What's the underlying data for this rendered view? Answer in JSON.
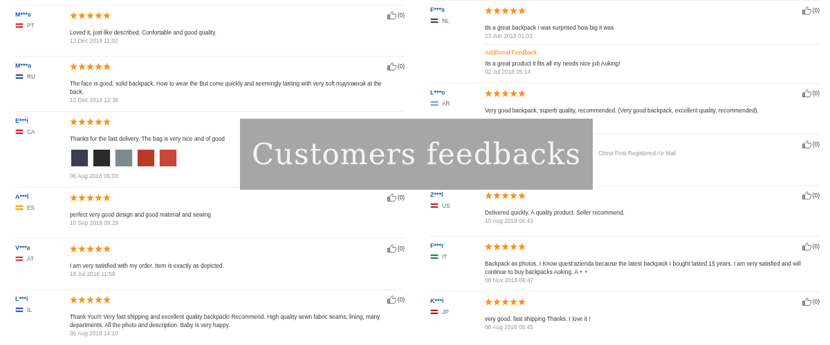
{
  "columns": [
    {
      "reviews": [
        {
          "user": "M***s",
          "country": "PT",
          "flag": {
            "color": "#d62828"
          },
          "stars": 5,
          "likes": "(0)",
          "comment": "Loved it, just like described. Confortable and good quality.",
          "date": "13 Dec 2018 11:02"
        },
        {
          "user": "M***a",
          "country": "RU",
          "flag": {
            "color": "#2a4fb0"
          },
          "stars": 5,
          "likes": "(0)",
          "comment": "The face is good, solid backpack. How to wear the But come quickly and seemingly lasting with very soft подложной at the back.",
          "date": "13 Dec 2018 12:36"
        },
        {
          "user": "E***i",
          "country": "CA",
          "flag": {
            "color": "#c8202e"
          },
          "stars": 5,
          "comment": "Thanks for the fast delivery. The bag is very nice and of good",
          "photos": [
            {
              "color": "#3a3d52"
            },
            {
              "color": "#2b2b2b"
            },
            {
              "color": "#7d8a8c"
            },
            {
              "color": "#b83a2a"
            },
            {
              "color": "#c9453a"
            }
          ],
          "date": "06 Aug 2018 06:03"
        },
        {
          "user": "A***l",
          "country": "ES",
          "flag": {
            "color": "#f0b400"
          },
          "stars": 5,
          "likes": "(0)",
          "comment": "perfect very good design and good material and sewing",
          "date": "10 Sep 2018 09:29"
        },
        {
          "user": "V***a",
          "country": "AT",
          "flag": {
            "color": "#e03c3c"
          },
          "stars": 5,
          "likes": "(0)",
          "comment": "I am very satisfied with my order. Item is exactly as depicted.",
          "date": "18 Jul 2018 11:58"
        },
        {
          "user": "L***i",
          "country": "IL",
          "flag": {
            "color": "#3355bb"
          },
          "stars": 5,
          "likes": "(0)",
          "comment": "Thank You!!! Very fast shipping and excellent quality backpack! Recommend. High quality sewn fabric seams, lining, many departments. All the photo and description. Baby is very happy.",
          "date": "06 Aug 2018 14:10"
        }
      ]
    },
    {
      "reviews": [
        {
          "user": "F***s",
          "country": "NL",
          "flag": {
            "color": "#21468b"
          },
          "stars": 5,
          "likes": "(0)",
          "comment": "Its a great backpack i was surprised how big it was",
          "date": "23 Jun 2018 01:03",
          "additional": {
            "label": "Additional Feedback",
            "comment": "Its a great product it fits all my needs nice job Aoking!",
            "date": "02 Jul 2018 05:14"
          }
        },
        {
          "user": "L***o",
          "country": "AR",
          "flag": {
            "color": "#74acdf"
          },
          "stars": 5,
          "likes": "(0)",
          "comment": "Very good backpack, superb quality, recommended. (Very good backpack, excellent quality, recommended)."
        },
        {
          "likes": "(0)",
          "logistics": "China Post Registered Air Mail"
        },
        {
          "user": "Z***l",
          "country": "US",
          "flag": {
            "color": "#b22234"
          },
          "stars": 5,
          "likes": "(0)",
          "comment": "Delivered quickly. A quality product. Seller recommend.",
          "date": "10 Aug 2018 06:43"
        },
        {
          "user": "F***r",
          "country": "IT",
          "flag": {
            "color": "#009246"
          },
          "stars": 5,
          "likes": "(0)",
          "comment": "Backpack as photos. I Know quest'azienda because the latest backpack I bought lasted 15 years. I am very satisfied and will continue to buy backpacks Aoking. A + +",
          "date": "08 Nov 2018 06:47"
        },
        {
          "user": "K***i",
          "country": "JP",
          "flag": {
            "color": "#bc002d"
          },
          "stars": 5,
          "likes": "(0)",
          "comment": "very good. fast shipping Thanks. I love it !",
          "date": "08 Aug 2018 05:45"
        }
      ]
    }
  ],
  "banner": {
    "title": "Customers feedbacks"
  }
}
